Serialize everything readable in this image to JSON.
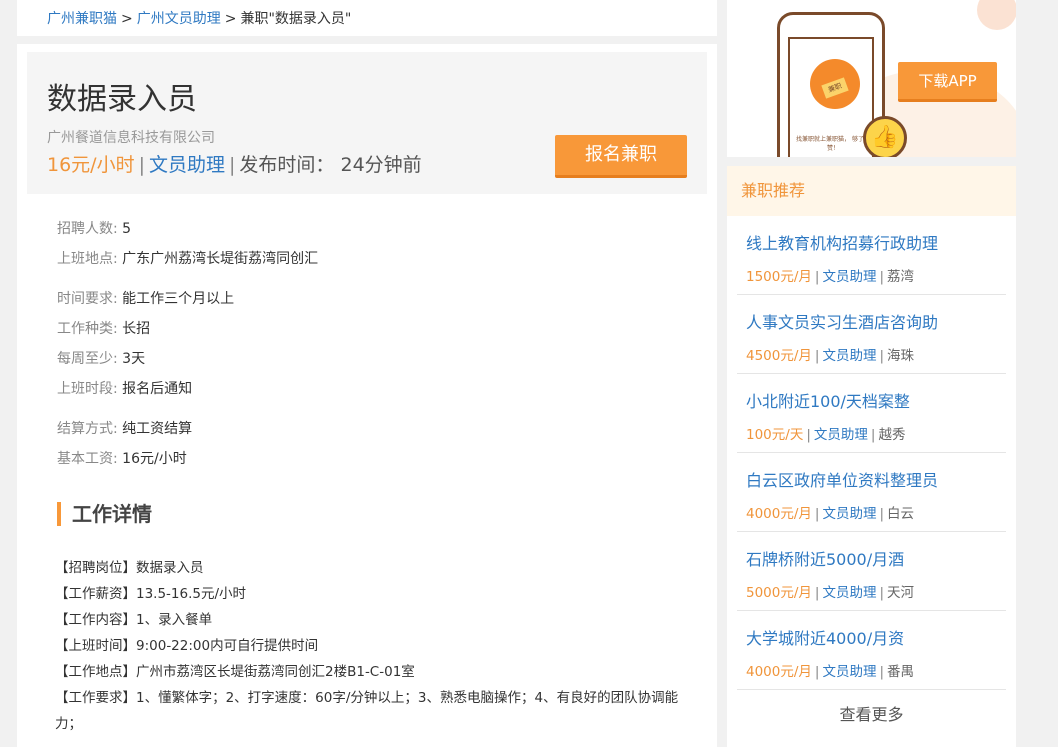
{
  "breadcrumb": {
    "items": [
      "广州兼职猫",
      "广州文员助理"
    ],
    "separator": ">",
    "current": "兼职\"数据录入员\""
  },
  "job": {
    "title": "数据录入员",
    "company": "广州餐道信息科技有限公司",
    "salary": "16元/小时",
    "category": "文员助理",
    "separator": "|",
    "published_label": "发布时间：",
    "published_value": "24分钟前",
    "apply_label": "报名兼职"
  },
  "fields": [
    {
      "k": "招聘人数:",
      "v": "5"
    },
    {
      "k": "上班地点:",
      "v": "广东广州荔湾长堤街荔湾同创汇"
    },
    {
      "k": "时间要求:",
      "v": "能工作三个月以上"
    },
    {
      "k": "工作种类:",
      "v": "长招"
    },
    {
      "k": "每周至少:",
      "v": "3天"
    },
    {
      "k": "上班时段:",
      "v": "报名后通知"
    },
    {
      "k": "结算方式:",
      "v": "纯工资结算"
    },
    {
      "k": "基本工资:",
      "v": "16元/小时"
    }
  ],
  "detail": {
    "heading": "工作详情",
    "lines": [
      "【招聘岗位】数据录入员",
      "【工作薪资】13.5-16.5元/小时",
      "【工作内容】1、录入餐单",
      "【上班时间】9:00-22:00内可自行提供时间",
      "【工作地点】广州市荔湾区长堤街荔湾同创汇2楼B1-C-01室",
      "【工作要求】1、懂繁体字；2、打字速度：60字/分钟以上；3、熟悉电脑操作；4、有良好的团队协调能力；"
    ]
  },
  "promo": {
    "download_label": "下载APP",
    "badge_text": "兼职",
    "phone_text": "找兼职就上兼职猫， 够了个赞！"
  },
  "sidebar": {
    "heading": "兼职推荐",
    "items": [
      {
        "title": "线上教育机构招募行政助理",
        "salary": "1500元/月",
        "category": "文员助理",
        "area": "荔湾"
      },
      {
        "title": "人事文员实习生酒店咨询助",
        "salary": "4500元/月",
        "category": "文员助理",
        "area": "海珠"
      },
      {
        "title": "小北附近100/天档案整",
        "salary": "100元/天",
        "category": "文员助理",
        "area": "越秀"
      },
      {
        "title": "白云区政府单位资料整理员",
        "salary": "4000元/月",
        "category": "文员助理",
        "area": "白云"
      },
      {
        "title": "石牌桥附近5000/月酒",
        "salary": "5000元/月",
        "category": "文员助理",
        "area": "天河"
      },
      {
        "title": "大学城附近4000/月资",
        "salary": "4000元/月",
        "category": "文员助理",
        "area": "番禺"
      }
    ],
    "more_label": "查看更多"
  }
}
